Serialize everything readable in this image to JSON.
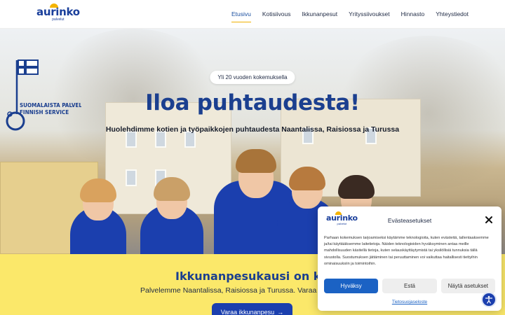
{
  "header": {
    "logo_text": "aurinko",
    "logo_sub": "palvelut",
    "nav": [
      {
        "label": "Etusivu",
        "active": true
      },
      {
        "label": "Kotisiivous"
      },
      {
        "label": "Ikkunanpesut"
      },
      {
        "label": "Yrityssiivoukset"
      },
      {
        "label": "Hinnasto"
      },
      {
        "label": "Yhteystiedot"
      }
    ]
  },
  "hero": {
    "badge_pill": "Yli 20 vuoden kokemuksella",
    "title": "Iloa puhtaudesta!",
    "subtitle": "Huolehdimme kotien ja työpaikkojen puhtaudesta Naantalissa, Raisiossa ja Turussa",
    "finnish_badge_line1": "SUOMALAISTA PALVELUA",
    "finnish_badge_line2": "FINNISH SERVICE"
  },
  "band": {
    "title": "Ikkunanpesukausi on käynnis",
    "text": "Palvelemme Naantalissa, Raisiossa ja Turussa. Varaa aikasi h",
    "button_label": "Varaa ikkunanpesu",
    "button_icon": "arrow-right-icon"
  },
  "cookie": {
    "title": "Evästeasetukset",
    "body": "Parhaan kokemuksen tarjoamiseksi käytämme teknologioita, kuten evästeitä, tallentaaksemme ja/tai käyttääksemme laitetietoja. Näiden teknologioiden hyväksyminen antaa meille mahdollisuuden käsitellä tietoja, kuten selauskäyttäytymistä tai yksilöllisiä tunnuksia tällä sivustolla. Suostumuksen jättäminen tai peruuttaminen voi vaikuttaa haitallisesti tiettyihin ominaisuuksiin ja toimintoihin.",
    "accept_label": "Hyväksy",
    "deny_label": "Estä",
    "prefs_label": "Näytä asetukset",
    "policy_link": "Tietosuojaseloste"
  },
  "colors": {
    "brand_blue": "#1b3f8f",
    "accent_yellow": "#fbe86a",
    "button_blue": "#1b62c4"
  }
}
